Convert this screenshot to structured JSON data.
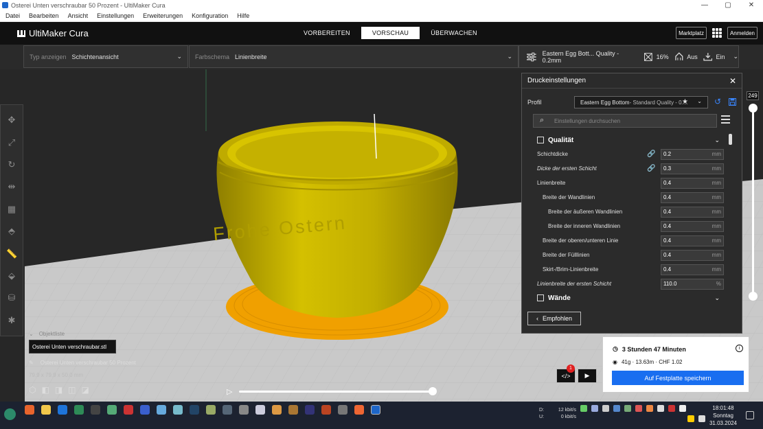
{
  "window": {
    "title": "Osterei Unten verschraubar 50 Prozent - UltiMaker Cura",
    "min": "—",
    "max": "▢",
    "close": "✕"
  },
  "menu": [
    "Datei",
    "Bearbeiten",
    "Ansicht",
    "Einstellungen",
    "Erweiterungen",
    "Konfiguration",
    "Hilfe"
  ],
  "header": {
    "logo_text": "UltiMaker Cura",
    "tabs": [
      "VORBEREITEN",
      "VORSCHAU",
      "ÜBERWACHEN"
    ],
    "active_tab": 1,
    "marketplace": "Marktplatz",
    "signin": "Anmelden"
  },
  "toolbar": {
    "view_type_label": "Typ anzeigen",
    "view_type_value": "Schichtenansicht",
    "color_scheme_label": "Farbschema",
    "color_scheme_value": "Linienbreite",
    "print_profile": "Eastern Egg Bott... Quality - 0.2mm",
    "infill": "16%",
    "support": "Aus",
    "adhesion": "Ein"
  },
  "layer_slider": {
    "value": "249"
  },
  "panel": {
    "title": "Druckeinstellungen",
    "profile_label": "Profil",
    "profile_value": "Eastern Egg Bottom",
    "profile_suffix": " - Standard Quality - 0....",
    "search_placeholder": "Einstellungen durchsuchen",
    "category_quality": "Qualität",
    "category_walls": "Wände",
    "settings": [
      {
        "label": "Schichtdicke",
        "value": "0.2",
        "unit": "mm",
        "italic": false,
        "indent": 0,
        "link": true
      },
      {
        "label": "Dicke der ersten Schicht",
        "value": "0.3",
        "unit": "mm",
        "italic": true,
        "indent": 0,
        "link": true
      },
      {
        "label": "Linienbreite",
        "value": "0.4",
        "unit": "mm",
        "italic": false,
        "indent": 0,
        "link": false
      },
      {
        "label": "Breite der Wandlinien",
        "value": "0.4",
        "unit": "mm",
        "italic": false,
        "indent": 1,
        "link": false
      },
      {
        "label": "Breite der äußeren Wandlinien",
        "value": "0.4",
        "unit": "mm",
        "italic": false,
        "indent": 2,
        "link": false
      },
      {
        "label": "Breite der inneren Wandlinien",
        "value": "0.4",
        "unit": "mm",
        "italic": false,
        "indent": 2,
        "link": false
      },
      {
        "label": "Breite der oberen/unteren Linie",
        "value": "0.4",
        "unit": "mm",
        "italic": false,
        "indent": 1,
        "link": false
      },
      {
        "label": "Breite der Fülllinien",
        "value": "0.4",
        "unit": "mm",
        "italic": false,
        "indent": 1,
        "link": false
      },
      {
        "label": "Skirt-/Brim-Linienbreite",
        "value": "0.4",
        "unit": "mm",
        "italic": false,
        "indent": 1,
        "link": false
      },
      {
        "label": "Linienbreite der ersten Schicht",
        "value": "110.0",
        "unit": "%",
        "italic": true,
        "indent": 0,
        "link": false
      }
    ],
    "recommended": "Empfohlen"
  },
  "objects": {
    "header": "Objektliste",
    "file": "Osterei Unten verschraubar.stl",
    "name": "Osterei Unten verschraubar 50 Prozent",
    "dims": "79.9 x 79.9 x 50.0 mm"
  },
  "estimate": {
    "time": "3 Stunden 47 Minuten",
    "material": "41g · 13.63m · CHF 1.02",
    "save": "Auf Festplatte speichern",
    "badge": "1"
  },
  "model": {
    "text": "Frohe Ostern",
    "body_color": "#c9b600",
    "brim_color": "#f0a000",
    "plate_color": "#c9c9c9"
  },
  "taskbar": {
    "net_down_label": "D:",
    "net_up_label": "U:",
    "net_down": "12 kbit/s",
    "net_up": "0 kbit/s",
    "time": "18:01:48",
    "day": "Sonntag",
    "date": "31.03.2024"
  }
}
